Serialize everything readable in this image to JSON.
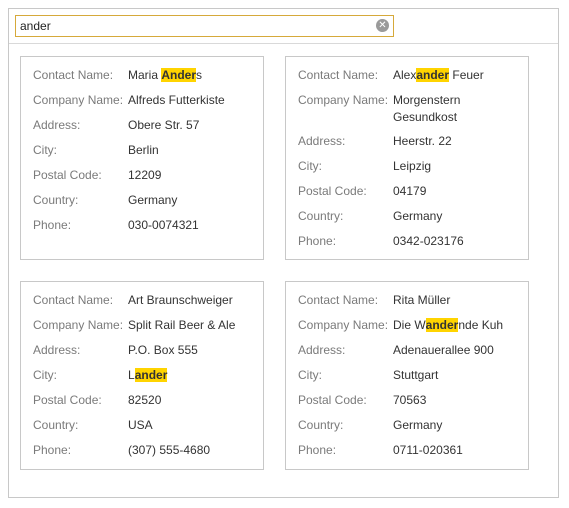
{
  "search": {
    "value": "ander",
    "placeholder": ""
  },
  "labels": {
    "contact_name": "Contact Name:",
    "company_name": "Company Name:",
    "address": "Address:",
    "city": "City:",
    "postal_code": "Postal Code:",
    "country": "Country:",
    "phone": "Phone:"
  },
  "highlight_color": "#ffd400",
  "cards": [
    {
      "contact_name": {
        "pre": "Maria ",
        "hl": "Ander",
        "post": "s"
      },
      "company_name": "Alfreds Futterkiste",
      "address": "Obere Str. 57",
      "city": "Berlin",
      "postal_code": "12209",
      "country": "Germany",
      "phone": "030-0074321"
    },
    {
      "contact_name": {
        "pre": "Alex",
        "hl": "ander",
        "post": " Feuer"
      },
      "company_name": "Morgenstern Gesundkost",
      "address": "Heerstr. 22",
      "city": "Leipzig",
      "postal_code": "04179",
      "country": "Germany",
      "phone": "0342-023176"
    },
    {
      "contact_name": "Art Braunschweiger",
      "company_name": "Split Rail Beer & Ale",
      "address": "P.O. Box 555",
      "city": {
        "pre": "L",
        "hl": "ander",
        "post": ""
      },
      "postal_code": "82520",
      "country": "USA",
      "phone": "(307) 555-4680"
    },
    {
      "contact_name": "Rita Müller",
      "company_name": {
        "pre": "Die W",
        "hl": "ander",
        "post": "nde Kuh"
      },
      "address": "Adenauerallee 900",
      "city": "Stuttgart",
      "postal_code": "70563",
      "country": "Germany",
      "phone": "0711-020361"
    }
  ]
}
